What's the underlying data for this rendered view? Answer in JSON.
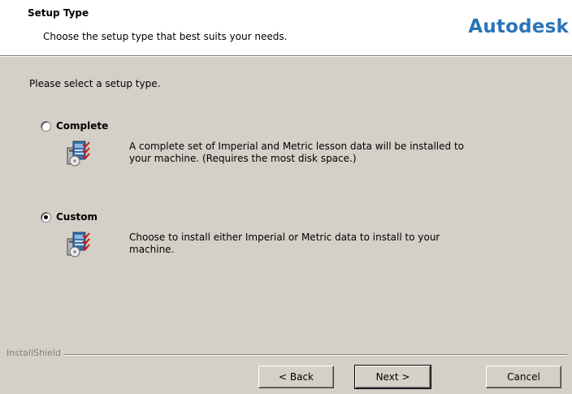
{
  "header": {
    "title": "Setup Type",
    "subtitle": "Choose the setup type that best suits your needs.",
    "logo_text": "Autodesk",
    "logo_color": "#2b74b8"
  },
  "main": {
    "prompt": "Please select a setup type.",
    "options": [
      {
        "label": "Complete",
        "selected": false,
        "icon": "setup-package-icon",
        "description_line1": "A complete set of Imperial and Metric lesson data will be installed to",
        "description_line2": "your machine. (Requires the most disk space.)"
      },
      {
        "label": "Custom",
        "selected": true,
        "icon": "setup-package-icon",
        "description_line1": "Choose to install either Imperial or Metric data to install to your",
        "description_line2": "machine."
      }
    ]
  },
  "footer": {
    "brand": "InstallShield",
    "buttons": {
      "back": "< Back",
      "next": "Next >",
      "cancel": "Cancel"
    }
  }
}
